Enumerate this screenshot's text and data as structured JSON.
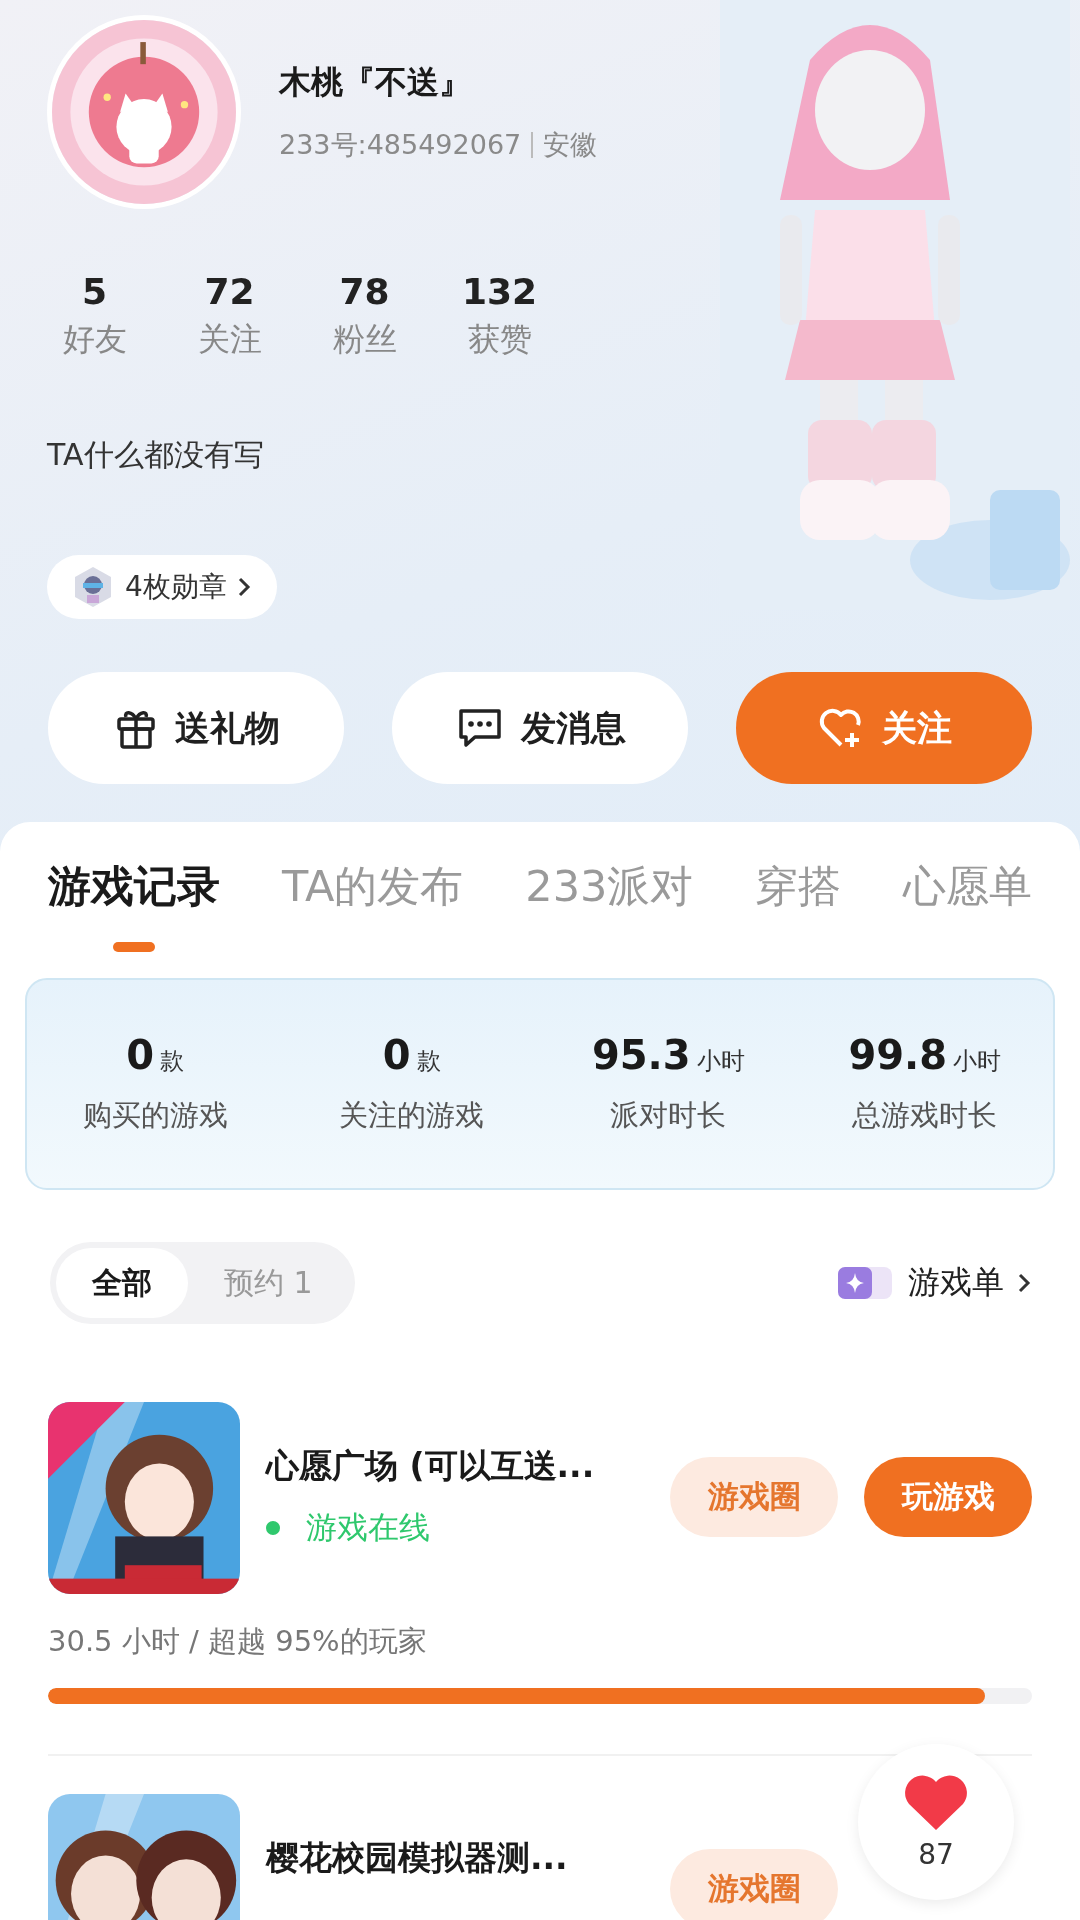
{
  "profile": {
    "name": "木桃『不送』",
    "id_text": "233号:485492067",
    "region": "安徽",
    "stats": [
      {
        "value": "5",
        "label": "好友"
      },
      {
        "value": "72",
        "label": "关注"
      },
      {
        "value": "78",
        "label": "粉丝"
      },
      {
        "value": "132",
        "label": "获赞"
      }
    ],
    "bio": "TA什么都没有写",
    "medals": "4枚勋章"
  },
  "actions": [
    {
      "kind": "gift",
      "label": "送礼物"
    },
    {
      "kind": "message",
      "label": "发消息"
    },
    {
      "kind": "follow",
      "label": "关注"
    }
  ],
  "tabs": [
    {
      "label": "游戏记录",
      "selected": true
    },
    {
      "label": "TA的发布",
      "selected": false
    },
    {
      "label": "233派对",
      "selected": false
    },
    {
      "label": "穿搭",
      "selected": false
    },
    {
      "label": "心愿单",
      "selected": false
    }
  ],
  "summary": [
    {
      "value": "0",
      "unit": "款",
      "label": "购买的游戏"
    },
    {
      "value": "0",
      "unit": "款",
      "label": "关注的游戏"
    },
    {
      "value": "95.3",
      "unit": "小时",
      "label": "派对时长"
    },
    {
      "value": "99.8",
      "unit": "小时",
      "label": "总游戏时长"
    }
  ],
  "filters": [
    {
      "label": "全部",
      "selected": true
    },
    {
      "label": "预约 1",
      "selected": false
    }
  ],
  "game_list_link": "游戏单",
  "games": [
    {
      "title": "心愿广场 (可以互送...",
      "status": "游戏在线",
      "circle_button": "游戏圈",
      "play_button": "玩游戏",
      "playtime": "30.5 小时 / 超越 95%的玩家",
      "level": 0.952
    },
    {
      "title": "樱花校园模拟器测...",
      "circle_button": "游戏圈"
    }
  ],
  "like_button": {
    "count": "87"
  }
}
